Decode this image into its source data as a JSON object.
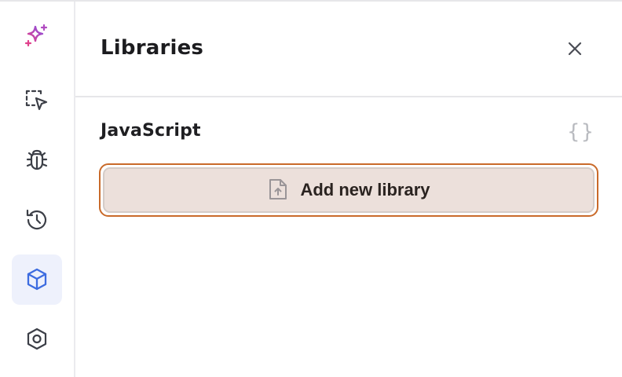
{
  "rail": {
    "items": [
      {
        "id": "ai",
        "icon": "sparkle-icon",
        "active": false
      },
      {
        "id": "select",
        "icon": "selection-cursor-icon",
        "active": false
      },
      {
        "id": "debug",
        "icon": "bug-icon",
        "active": false
      },
      {
        "id": "history",
        "icon": "history-icon",
        "active": false
      },
      {
        "id": "libraries",
        "icon": "cube-icon",
        "active": true
      },
      {
        "id": "settings",
        "icon": "hexagon-settings-icon",
        "active": false
      }
    ],
    "colors": {
      "icon": "#3c3f47",
      "active_icon": "#3d6ce0",
      "active_bg": "#eef1fc",
      "sparkle_start": "#e0408c",
      "sparkle_end": "#8a50e0"
    }
  },
  "panel": {
    "title": "Libraries",
    "close_icon": "close-icon",
    "section": {
      "title": "JavaScript",
      "icon": "braces-icon",
      "icon_glyph": "{}"
    },
    "add_button": {
      "label": "Add new library",
      "icon": "file-upload-icon",
      "colors": {
        "border": "#c96a2a",
        "fill": "#ece0db"
      }
    }
  }
}
